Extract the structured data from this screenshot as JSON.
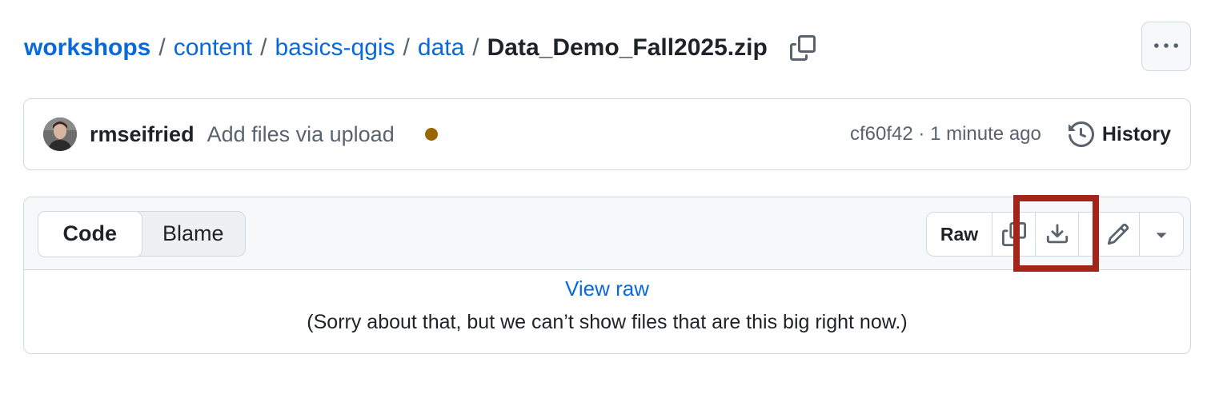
{
  "breadcrumb": {
    "links": [
      "workshops",
      "content",
      "basics-qgis",
      "data"
    ],
    "separator": "/",
    "current": "Data_Demo_Fall2025.zip"
  },
  "icons": {
    "copy_path": "copy-icon",
    "more": "kebab-horizontal-icon",
    "history": "history-icon",
    "copy_raw": "copy-icon",
    "download": "download-icon",
    "edit": "pencil-icon",
    "dropdown": "triangle-down-icon"
  },
  "commit": {
    "author": "rmseifried",
    "message": "Add files via upload",
    "status_color": "#9a6700",
    "sha": "cf60f42",
    "separator": "·",
    "time": "1 minute ago",
    "history_label": "History"
  },
  "file": {
    "tabs": [
      "Code",
      "Blame"
    ],
    "active_tab": "Code",
    "raw_label": "Raw",
    "view_raw_label": "View raw",
    "notice": "(Sorry about that, but we can’t show files that are this big right now.)"
  },
  "colors": {
    "link": "#0969da",
    "highlight_box": "#a32418"
  }
}
